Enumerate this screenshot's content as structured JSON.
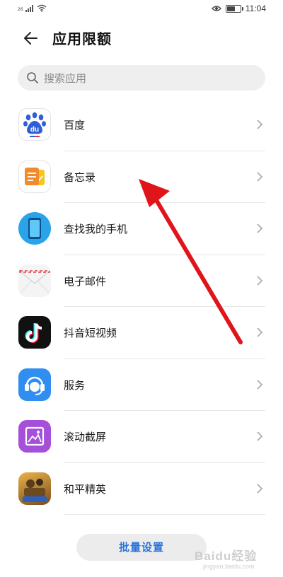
{
  "status_bar": {
    "network_type": "26",
    "time": "11:04",
    "icons": [
      "signal-icon",
      "wifi-icon",
      "eye-comfort-icon",
      "battery-icon"
    ]
  },
  "header": {
    "title": "应用限额",
    "back_icon": "back-arrow-icon"
  },
  "search": {
    "placeholder": "搜索应用",
    "icon": "search-icon"
  },
  "apps": [
    {
      "name": "百度",
      "icon": "baidu-icon"
    },
    {
      "name": "备忘录",
      "icon": "memo-icon"
    },
    {
      "name": "查找我的手机",
      "icon": "find-phone-icon"
    },
    {
      "name": "电子邮件",
      "icon": "email-icon"
    },
    {
      "name": "抖音短视频",
      "icon": "douyin-icon"
    },
    {
      "name": "服务",
      "icon": "service-icon"
    },
    {
      "name": "滚动截屏",
      "icon": "scroll-screenshot-icon"
    },
    {
      "name": "和平精英",
      "icon": "game-peace-elite-icon"
    }
  ],
  "batch_button": {
    "label": "批量设置"
  },
  "watermark": {
    "text": "Baidu经验",
    "url": "jingyan.baidu.com"
  },
  "colors": {
    "accent": "#2a73d9",
    "annotation_arrow": "#e0141b"
  }
}
